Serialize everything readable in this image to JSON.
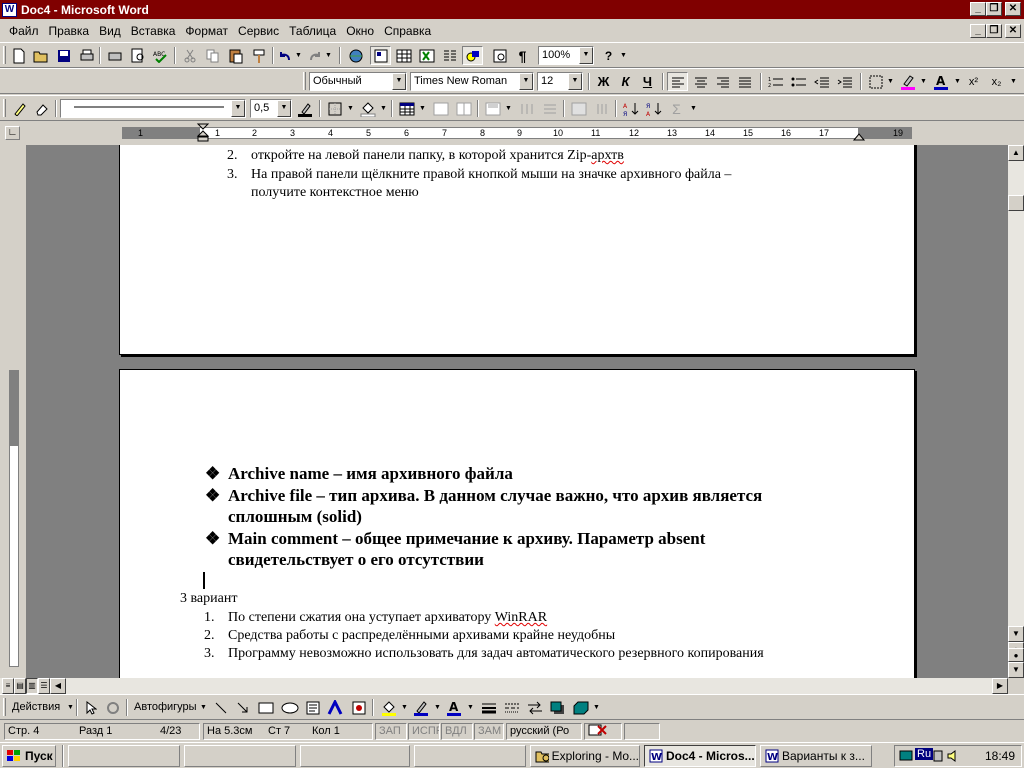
{
  "window": {
    "title": "Doc4 - Microsoft Word",
    "icon_letter": "W"
  },
  "menu": [
    "Файл",
    "Правка",
    "Вид",
    "Вставка",
    "Формат",
    "Сервис",
    "Таблица",
    "Окно",
    "Справка"
  ],
  "toolbar": {
    "zoom": "100%",
    "help_label": "?"
  },
  "formatting": {
    "style": "Обычный",
    "font": "Times New Roman",
    "size": "12",
    "bold": "Ж",
    "italic": "К",
    "underline": "Ч",
    "superscript": "x²",
    "subscript": "x₂"
  },
  "drawing_top": {
    "line_weight": "0,5"
  },
  "ruler": {
    "numbers": [
      "1",
      "1",
      "2",
      "3",
      "4",
      "5",
      "6",
      "7",
      "8",
      "9",
      "10",
      "11",
      "12",
      "13",
      "14",
      "15",
      "16",
      "17",
      "19"
    ]
  },
  "page1": {
    "items": [
      {
        "num": "2.",
        "text_pre": "откройте на левой панели папку, в которой хранится Zip-",
        "text_err": "архтв",
        "text_post": ""
      },
      {
        "num": "3.",
        "text": "На правой панели щёлкните правой кнопкой мыши на значке архивного файла –"
      },
      {
        "num": "",
        "text": "получите контекстное меню"
      }
    ]
  },
  "page2": {
    "bullets": [
      {
        "line1": "Archive name – имя архивного файла",
        "line2": ""
      },
      {
        "line1": "Archive file – тип архива. В данном случае важно, что архив является",
        "line2": "сплошным (solid)"
      },
      {
        "line1": "Main comment – общее примечание к архиву. Параметр absent",
        "line2": "свидетельствует о его отсутствии"
      }
    ],
    "heading": "3 вариант",
    "list": [
      {
        "num": "1.",
        "text_pre": "По степени сжатия она уступает архиватору ",
        "text_err": "WinRAR"
      },
      {
        "num": "2.",
        "text_pre": "Средства работы с распределёнными архивами крайне неудобны",
        "text_err": ""
      },
      {
        "num": "3.",
        "text_pre": "Программу невозможно использовать для задач автоматического резервного копирования",
        "text_err": ""
      }
    ]
  },
  "drawbar": {
    "actions": "Действия",
    "autoshapes": "Автофигуры"
  },
  "status": {
    "page": "Стр. 4",
    "section": "Разд 1",
    "pages": "4/23",
    "at": "На 5.3см",
    "line": "Ст 7",
    "col": "Кол 1",
    "rec": "ЗАП",
    "trk": "ИСПР",
    "ext": "ВДЛ",
    "ovr": "ЗАМ",
    "lang": "русский (Ро"
  },
  "taskbar": {
    "start": "Пуск",
    "tasks": [
      "Exploring - Mo...",
      "Doc4 - Micros...",
      "Варианты  к з..."
    ],
    "tray_lang": "Ru",
    "clock": "18:49"
  }
}
